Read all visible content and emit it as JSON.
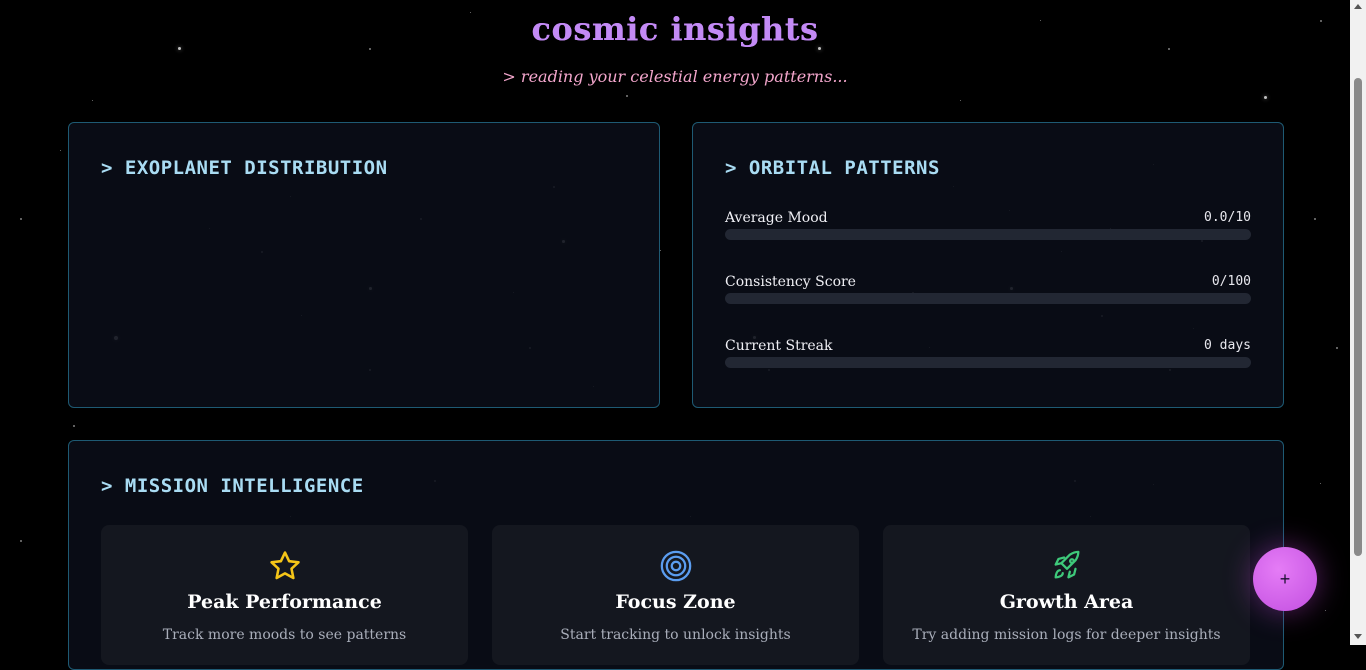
{
  "header": {
    "title": "cosmic insights",
    "subtitle": "> reading your celestial energy patterns..."
  },
  "exoplanet_panel": {
    "title": "> EXOPLANET DISTRIBUTION"
  },
  "orbital_panel": {
    "title": "> ORBITAL PATTERNS",
    "metrics": [
      {
        "label": "Average Mood",
        "value": "0.0/10",
        "progress": 0
      },
      {
        "label": "Consistency Score",
        "value": "0/100",
        "progress": 0
      },
      {
        "label": "Current Streak",
        "value": "0 days",
        "progress": 0
      }
    ]
  },
  "mission_panel": {
    "title": "> MISSION INTELLIGENCE",
    "cards": [
      {
        "icon": "star-icon",
        "title": "Peak Performance",
        "description": "Track more moods to see patterns",
        "icon_color": "#f5c518"
      },
      {
        "icon": "target-icon",
        "title": "Focus Zone",
        "description": "Start tracking to unlock insights",
        "icon_color": "#5b9df0"
      },
      {
        "icon": "rocket-icon",
        "title": "Growth Area",
        "description": "Try adding mission logs for deeper insights",
        "icon_color": "#3ec97a"
      }
    ]
  },
  "fab": {
    "label": "+",
    "color": "#d966f0"
  },
  "colors": {
    "accent": "#c084fc",
    "panel_border": "#1e5a73",
    "panel_title": "#a9dcf3"
  }
}
